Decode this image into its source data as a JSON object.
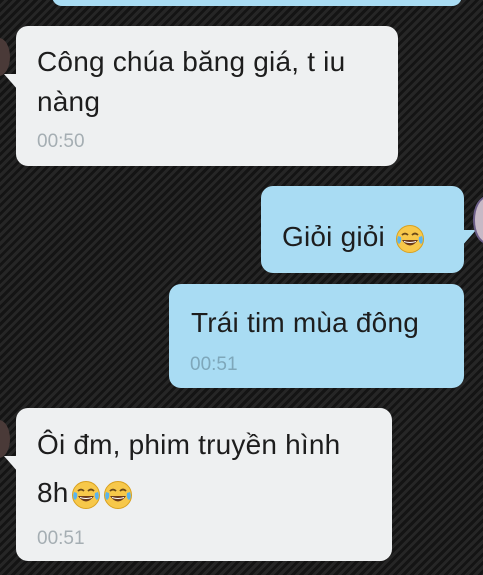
{
  "messages": [
    {
      "direction": "incoming",
      "line1": "Công chúa băng giá, t iu",
      "line2": "nàng",
      "time": "00:50"
    },
    {
      "direction": "outgoing",
      "text": "Giỏi giỏi",
      "emoji": "face-with-tears-of-joy-icon"
    },
    {
      "direction": "outgoing",
      "text": "Trái tim mùa đông",
      "time": "00:51"
    },
    {
      "direction": "incoming",
      "line1": "Ôi đm, phim truyền hình",
      "line2": "8h",
      "emoji": "face-with-tears-of-joy-icon",
      "emoji_count": 2,
      "time": "00:51"
    }
  ],
  "colors": {
    "incoming_bubble": "#eef0f1",
    "outgoing_bubble": "#a9dcf3",
    "timestamp": "#a5aeb3",
    "background": "#1c1c1c"
  }
}
